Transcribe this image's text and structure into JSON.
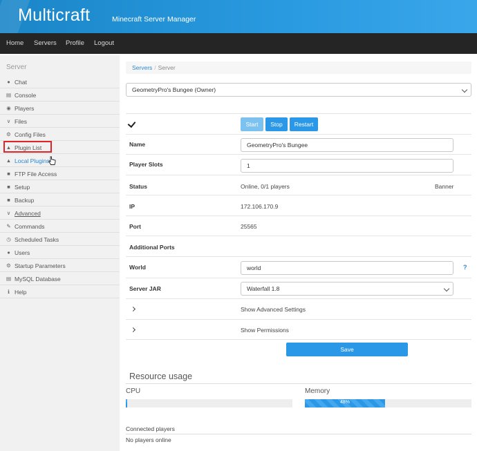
{
  "header": {
    "brand": "Multicraft",
    "tagline": "Minecraft Server Manager"
  },
  "nav": {
    "items": [
      "Home",
      "Servers",
      "Profile",
      "Logout"
    ]
  },
  "sidebar": {
    "title": "Server",
    "items": [
      {
        "label": "Chat",
        "icon": "chat-icon"
      },
      {
        "label": "Console",
        "icon": "console-icon"
      },
      {
        "label": "Players",
        "icon": "players-icon"
      },
      {
        "label": "Files",
        "icon": "chevron-down-icon"
      },
      {
        "label": "Config Files",
        "icon": "gear-icon"
      },
      {
        "label": "Plugin List",
        "icon": "plugin-icon"
      },
      {
        "label": "Local Plugins",
        "icon": "plugin-icon"
      },
      {
        "label": "FTP File Access",
        "icon": "file-icon"
      },
      {
        "label": "Setup",
        "icon": "file-icon"
      },
      {
        "label": "Backup",
        "icon": "file-icon"
      },
      {
        "label": "Advanced",
        "icon": "chevron-down-icon"
      },
      {
        "label": "Commands",
        "icon": "edit-icon"
      },
      {
        "label": "Scheduled Tasks",
        "icon": "clock-icon"
      },
      {
        "label": "Users",
        "icon": "user-icon"
      },
      {
        "label": "Startup Parameters",
        "icon": "gear-icon"
      },
      {
        "label": "MySQL Database",
        "icon": "database-icon"
      },
      {
        "label": "Help",
        "icon": "info-icon"
      }
    ]
  },
  "breadcrumb": {
    "root": "Servers",
    "sep": "/",
    "current": "Server"
  },
  "server_select": {
    "value": "GeometryPro's Bungee (Owner)"
  },
  "controls": {
    "start": "Start",
    "stop": "Stop",
    "restart": "Restart"
  },
  "fields": {
    "name_label": "Name",
    "name_value": "GeometryPro's Bungee",
    "slots_label": "Player Slots",
    "slots_value": "1",
    "status_label": "Status",
    "status_value": "Online, 0/1 players",
    "banner": "Banner",
    "ip_label": "IP",
    "ip_value": "172.106.170.9",
    "port_label": "Port",
    "port_value": "25565",
    "addports_label": "Additional Ports",
    "world_label": "World",
    "world_value": "world",
    "world_help": "?",
    "jar_label": "Server JAR",
    "jar_value": "Waterfall 1.8",
    "adv_settings": "Show Advanced Settings",
    "permissions": "Show Permissions"
  },
  "save_label": "Save",
  "resources": {
    "title": "Resource usage",
    "cpu_label": "CPU",
    "cpu_fraction": 0.01,
    "memory_label": "Memory",
    "memory_percent": "48%",
    "memory_fraction": 0.48
  },
  "players": {
    "label": "Connected players",
    "empty": "No players online"
  },
  "colors": {
    "accent": "#2a98e6",
    "header": "#1a86c8",
    "navbar": "#252525",
    "highlight": "#e0222a"
  }
}
